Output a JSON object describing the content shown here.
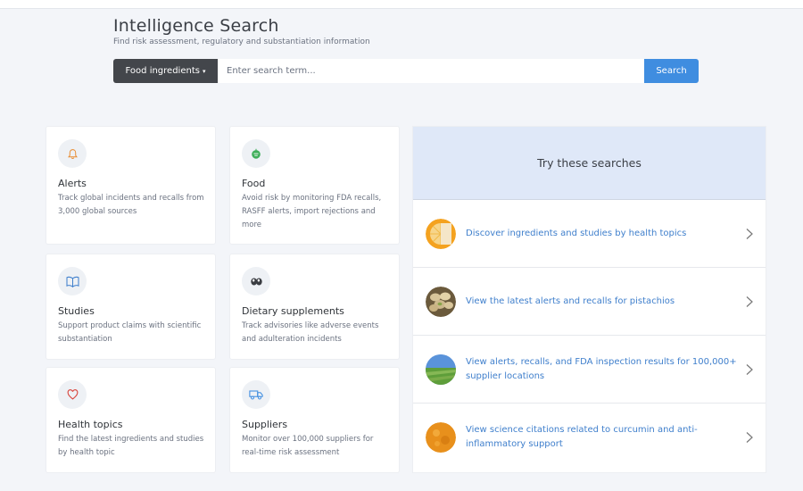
{
  "header": {
    "title": "Intelligence Search",
    "subtitle": "Find risk assessment, regulatory and substantiation information"
  },
  "search": {
    "category": "Food ingredients",
    "placeholder": "Enter search term...",
    "button_label": "Search"
  },
  "cards": [
    {
      "title": "Alerts",
      "desc": "Track global incidents and recalls from 3,000 global sources",
      "icon": "bell-icon"
    },
    {
      "title": "Food",
      "desc": "Avoid risk by monitoring FDA recalls, RASFF alerts, import rejections and more",
      "icon": "food-icon"
    },
    {
      "title": "Studies",
      "desc": "Support product claims with scientific substantiation",
      "icon": "book-icon"
    },
    {
      "title": "Dietary supplements",
      "desc": "Track advisories like adverse events and adulteration incidents",
      "icon": "pills-icon"
    },
    {
      "title": "Health topics",
      "desc": "Find the latest ingredients and studies by health topic",
      "icon": "heart-icon"
    },
    {
      "title": "Suppliers",
      "desc": "Monitor over 100,000 suppliers for real-time risk assessment",
      "icon": "truck-icon"
    }
  ],
  "try_searches": {
    "title": "Try these searches",
    "items": [
      {
        "text": "Discover ingredients and studies by health topics",
        "thumb": "orange-slice-thumb"
      },
      {
        "text": "View the latest alerts and recalls for pistachios",
        "thumb": "pistachio-thumb"
      },
      {
        "text": "View alerts, recalls, and FDA inspection results for 100,000+ supplier locations",
        "thumb": "field-thumb"
      },
      {
        "text": "View science citations related to curcumin and anti-inflammatory support",
        "thumb": "turmeric-thumb"
      }
    ]
  },
  "colors": {
    "accent": "#3f8de0",
    "link": "#3f7fcc",
    "select_bg": "#43464b",
    "panel_header": "#dfe8f8"
  }
}
